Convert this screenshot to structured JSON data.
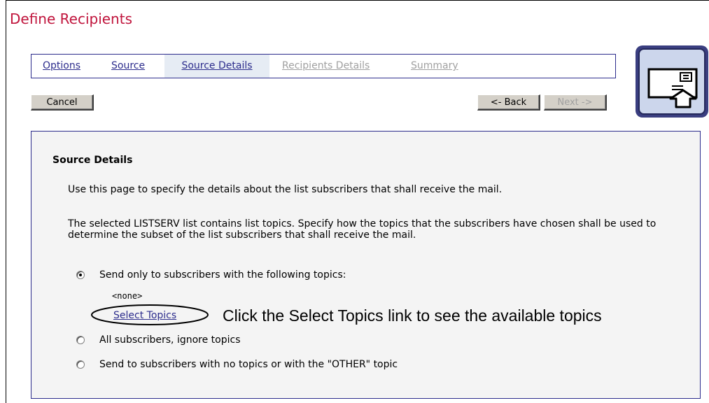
{
  "page": {
    "title": "Define Recipients"
  },
  "tabs": [
    {
      "label": "Options",
      "state": "link"
    },
    {
      "label": "Source",
      "state": "link"
    },
    {
      "label": "Source Details",
      "state": "active"
    },
    {
      "label": "Recipients Details",
      "state": "disabled"
    },
    {
      "label": "Summary",
      "state": "disabled"
    }
  ],
  "toolbar": {
    "cancel_label": "Cancel",
    "back_label": "<- Back",
    "next_label": "Next ->"
  },
  "logo": {
    "icon": "mail-send-icon"
  },
  "panel": {
    "heading": "Source Details",
    "intro": "Use this page to specify the details about the list subscribers that shall receive the mail.",
    "description": "The selected LISTSERV list contains list topics. Specify how the topics that the subscribers have chosen shall be used to determine the subset of the list subscribers that shall receive the mail.",
    "options": [
      {
        "label": "Send only to subscribers with the following topics:",
        "checked": true
      },
      {
        "label": "All subscribers, ignore topics",
        "checked": false
      },
      {
        "label": "Send to subscribers with no topics or with the \"OTHER\" topic",
        "checked": false
      }
    ],
    "selected_topics": "<none>",
    "select_topics_link": "Select Topics",
    "annotation": "Click the Select Topics link to see the available topics"
  },
  "colors": {
    "title": "#c0143c",
    "link": "#2c2c8c",
    "border": "#2c2c8c",
    "active_tab_bg": "#e6ecf4",
    "disabled": "#a0a0a0"
  }
}
